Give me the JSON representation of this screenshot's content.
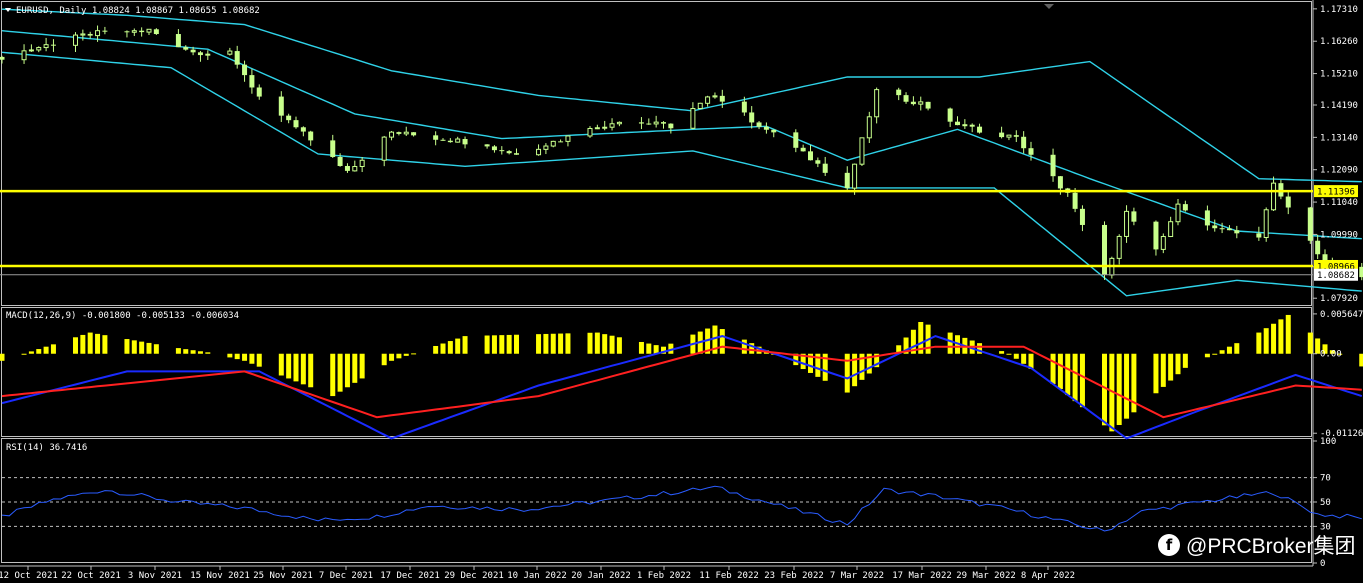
{
  "chart_header": {
    "symbol": "EURUSD",
    "timeframe": "Daily",
    "ohlc": "1.08824 1.08867 1.08655 1.08682",
    "menu_icon": "triangle-down-icon",
    "autoscroll_icon": "triangle-down-icon"
  },
  "colors": {
    "background": "#000000",
    "candle": "#c8ff8c",
    "bollinger": "#2fd2e8",
    "levels": "#ffff00",
    "macd_hist": "#ffff00",
    "macd_line": "#1a2bff",
    "signal_line": "#ff2020",
    "rsi_line": "#2a5cff",
    "grid": "#c0c0c0",
    "price_label_bg": "#ffff00"
  },
  "price_axis": {
    "ticks": [
      "1.17310",
      "1.16260",
      "1.15210",
      "1.14190",
      "1.13140",
      "1.12090",
      "1.11040",
      "1.09990",
      "1.08940",
      "1.07920"
    ],
    "levels": [
      {
        "label": "1.11396",
        "value": 1.11396
      },
      {
        "label": "1.08966",
        "value": 1.08966
      }
    ],
    "current_price": {
      "label": "1.08682",
      "value": 1.08682
    }
  },
  "macd": {
    "header": "MACD(12,26,9) -0.001800 -0.005133 -0.006034",
    "ticks": [
      "0.005647",
      "0.00",
      "-0.011265"
    ]
  },
  "rsi": {
    "header": "RSI(14) 36.7416",
    "ticks": [
      "100",
      "70",
      "50",
      "30",
      "0"
    ]
  },
  "time_axis": [
    "12 Oct 2021",
    "22 Oct 2021",
    "3 Nov 2021",
    "15 Nov 2021",
    "25 Nov 2021",
    "7 Dec 2021",
    "17 Dec 2021",
    "29 Dec 2021",
    "10 Jan 2022",
    "20 Jan 2022",
    "1 Feb 2022",
    "11 Feb 2022",
    "23 Feb 2022",
    "7 Mar 2022",
    "17 Mar 2022",
    "29 Mar 2022",
    "8 Apr 2022"
  ],
  "watermark": {
    "icon": "facebook-icon",
    "icon_glyph": "f",
    "text": "@PRCBroker集团"
  },
  "chart_data": [
    {
      "type": "candlestick",
      "title": "EURUSD, Daily",
      "ylim": [
        1.077,
        1.175
      ],
      "x_start": "2021-10-08",
      "close_path": [
        [
          "2021-10-08",
          1.1575
        ],
        [
          "2021-10-20",
          1.165
        ],
        [
          "2021-10-28",
          1.166
        ],
        [
          "2021-11-03",
          1.159
        ],
        [
          "2021-11-08",
          1.159
        ],
        [
          "2021-11-12",
          1.1445
        ],
        [
          "2021-11-24",
          1.1205
        ],
        [
          "2021-11-30",
          1.133
        ],
        [
          "2021-12-10",
          1.13
        ],
        [
          "2021-12-17",
          1.126
        ],
        [
          "2021-12-31",
          1.137
        ],
        [
          "2022-01-07",
          1.135
        ],
        [
          "2022-01-13",
          1.1455
        ],
        [
          "2022-01-18",
          1.137
        ],
        [
          "2022-01-26",
          1.1245
        ],
        [
          "2022-01-31",
          1.115
        ],
        [
          "2022-02-04",
          1.146
        ],
        [
          "2022-02-10",
          1.1425
        ],
        [
          "2022-02-15",
          1.1355
        ],
        [
          "2022-02-23",
          1.131
        ],
        [
          "2022-03-02",
          1.113
        ],
        [
          "2022-03-07",
          1.086
        ],
        [
          "2022-03-10",
          1.107
        ],
        [
          "2022-03-14",
          1.095
        ],
        [
          "2022-03-17",
          1.109
        ],
        [
          "2022-03-22",
          1.102
        ],
        [
          "2022-03-28",
          1.0985
        ],
        [
          "2022-03-30",
          1.116
        ],
        [
          "2022-04-04",
          1.097
        ],
        [
          "2022-04-06",
          1.0905
        ],
        [
          "2022-04-11",
          1.0868
        ]
      ],
      "bollinger_upper": [
        [
          "2021-10-08",
          1.173
        ],
        [
          "2021-10-25",
          1.171
        ],
        [
          "2021-11-10",
          1.168
        ],
        [
          "2021-11-30",
          1.153
        ],
        [
          "2021-12-20",
          1.145
        ],
        [
          "2022-01-10",
          1.14
        ],
        [
          "2022-01-31",
          1.151
        ],
        [
          "2022-02-18",
          1.151
        ],
        [
          "2022-03-05",
          1.156
        ],
        [
          "2022-03-28",
          1.118
        ],
        [
          "2022-04-11",
          1.117
        ]
      ],
      "bollinger_middle": [
        [
          "2021-10-08",
          1.166
        ],
        [
          "2021-11-05",
          1.16
        ],
        [
          "2021-11-25",
          1.139
        ],
        [
          "2021-12-15",
          1.131
        ],
        [
          "2022-01-10",
          1.134
        ],
        [
          "2022-01-20",
          1.135
        ],
        [
          "2022-01-31",
          1.124
        ],
        [
          "2022-02-15",
          1.134
        ],
        [
          "2022-03-05",
          1.118
        ],
        [
          "2022-03-25",
          1.101
        ],
        [
          "2022-04-11",
          1.0985
        ]
      ],
      "bollinger_lower": [
        [
          "2021-10-08",
          1.159
        ],
        [
          "2021-10-31",
          1.154
        ],
        [
          "2021-11-20",
          1.126
        ],
        [
          "2021-12-10",
          1.122
        ],
        [
          "2022-01-10",
          1.127
        ],
        [
          "2022-01-31",
          1.115
        ],
        [
          "2022-02-20",
          1.115
        ],
        [
          "2022-03-10",
          1.08
        ],
        [
          "2022-03-25",
          1.085
        ],
        [
          "2022-04-11",
          1.0815
        ]
      ],
      "horizontal_levels": [
        1.11396,
        1.08966
      ]
    },
    {
      "type": "bar",
      "title": "MACD(12,26,9) -0.001800 -0.005133 -0.006034",
      "ylim": [
        -0.0118,
        0.0062
      ],
      "histogram_path": [
        [
          "2021-10-08",
          -0.001
        ],
        [
          "2021-10-20",
          0.003
        ],
        [
          "2021-11-01",
          0.0008
        ],
        [
          "2021-11-05",
          0.0002
        ],
        [
          "2021-11-10",
          -0.001
        ],
        [
          "2021-11-22",
          -0.006
        ],
        [
          "2021-11-30",
          -0.001
        ],
        [
          "2021-12-10",
          0.0025
        ],
        [
          "2021-12-28",
          0.003
        ],
        [
          "2022-01-06",
          0.001
        ],
        [
          "2022-01-13",
          0.004
        ],
        [
          "2022-01-22",
          -0.0005
        ],
        [
          "2022-01-31",
          -0.0055
        ],
        [
          "2022-02-05",
          -0.001
        ],
        [
          "2022-02-10",
          0.0045
        ],
        [
          "2022-02-22",
          0.0
        ],
        [
          "2022-03-01",
          -0.005
        ],
        [
          "2022-03-08",
          -0.011
        ],
        [
          "2022-03-18",
          -0.002
        ],
        [
          "2022-03-28",
          0.003
        ],
        [
          "2022-04-01",
          0.0055
        ],
        [
          "2022-04-07",
          0.0005
        ],
        [
          "2022-04-11",
          -0.0018
        ]
      ],
      "series": [
        {
          "name": "MACD",
          "color": "blue",
          "path": [
            [
              "2021-10-08",
              -0.007
            ],
            [
              "2021-10-25",
              -0.0025
            ],
            [
              "2021-11-12",
              -0.0025
            ],
            [
              "2021-11-30",
              -0.012
            ],
            [
              "2021-12-20",
              -0.0045
            ],
            [
              "2022-01-14",
              0.0025
            ],
            [
              "2022-01-31",
              -0.0035
            ],
            [
              "2022-02-12",
              0.0025
            ],
            [
              "2022-02-25",
              -0.002
            ],
            [
              "2022-03-10",
              -0.012
            ],
            [
              "2022-03-20",
              -0.008
            ],
            [
              "2022-04-02",
              -0.003
            ],
            [
              "2022-04-11",
              -0.006
            ]
          ]
        },
        {
          "name": "Signal",
          "color": "red",
          "path": [
            [
              "2021-10-08",
              -0.006
            ],
            [
              "2021-11-10",
              -0.0025
            ],
            [
              "2021-11-28",
              -0.009
            ],
            [
              "2021-12-20",
              -0.006
            ],
            [
              "2022-01-14",
              0.001
            ],
            [
              "2022-01-31",
              -0.001
            ],
            [
              "2022-02-12",
              0.001
            ],
            [
              "2022-02-24",
              0.001
            ],
            [
              "2022-03-15",
              -0.009
            ],
            [
              "2022-04-02",
              -0.0045
            ],
            [
              "2022-04-11",
              -0.0051
            ]
          ]
        }
      ]
    },
    {
      "type": "line",
      "title": "RSI(14) 36.7416",
      "ylim": [
        0,
        100
      ],
      "levels": [
        30,
        50,
        70
      ],
      "series": [
        {
          "name": "RSI(14)",
          "path": [
            [
              "2021-10-08",
              38
            ],
            [
              "2021-10-15",
              52
            ],
            [
              "2021-10-22",
              60
            ],
            [
              "2021-11-01",
              50
            ],
            [
              "2021-11-10",
              45
            ],
            [
              "2021-11-20",
              35
            ],
            [
              "2021-11-28",
              38
            ],
            [
              "2021-12-05",
              47
            ],
            [
              "2021-12-18",
              44
            ],
            [
              "2021-12-29",
              51
            ],
            [
              "2022-01-13",
              62
            ],
            [
              "2022-01-20",
              50
            ],
            [
              "2022-01-31",
              32
            ],
            [
              "2022-02-05",
              60
            ],
            [
              "2022-02-12",
              55
            ],
            [
              "2022-02-22",
              44
            ],
            [
              "2022-03-07",
              26
            ],
            [
              "2022-03-12",
              42
            ],
            [
              "2022-03-20",
              50
            ],
            [
              "2022-03-30",
              58
            ],
            [
              "2022-04-05",
              40
            ],
            [
              "2022-04-11",
              37
            ]
          ]
        }
      ]
    }
  ]
}
